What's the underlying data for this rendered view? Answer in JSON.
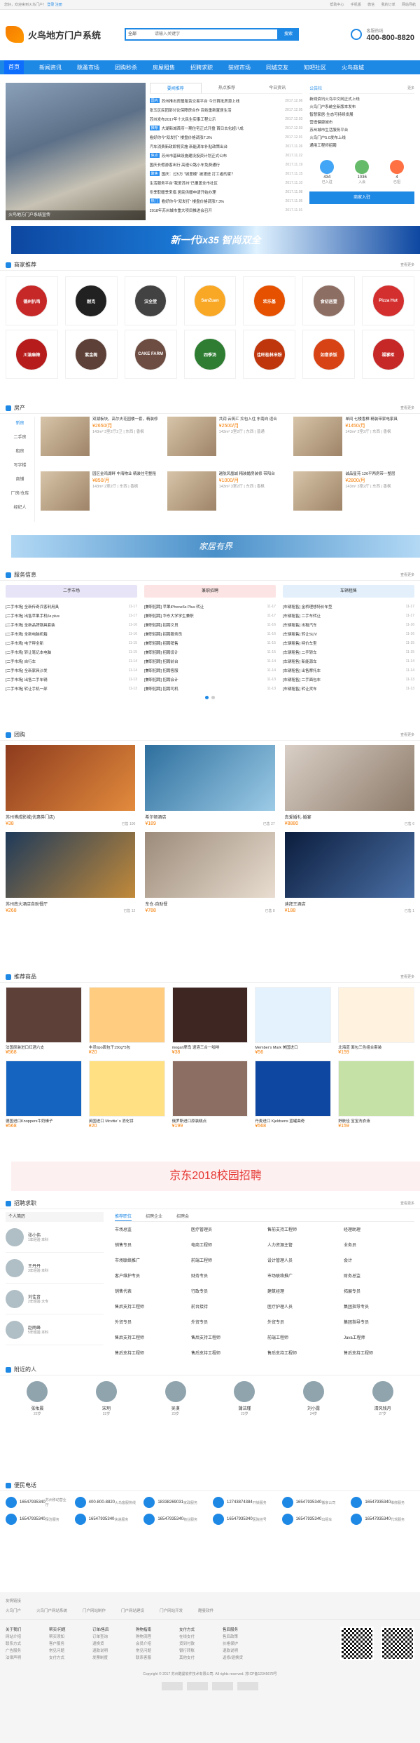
{
  "topbar": {
    "left": "您好，欢迎来到火鸟门户！",
    "login": "登录",
    "register": "注册",
    "right": [
      "帮助中心",
      "手机版",
      "微信",
      "我的订单",
      "网站导航"
    ]
  },
  "header": {
    "site": "火鸟地方门户系统",
    "search_cat": "全部",
    "search_placeholder": "请输入关键字",
    "search_btn": "搜索",
    "hot_label": "客服热线",
    "hot_phone": "400-800-8820"
  },
  "nav": [
    "首页",
    "新闻资讯",
    "跳蚤市场",
    "团购秒杀",
    "房屋租售",
    "招聘求职",
    "装修市场",
    "同城交友",
    "知吧社区",
    "火鸟商城"
  ],
  "hero": {
    "caption": "火鸟地方门户系统宣传",
    "tabs": [
      "要闻推荐",
      "热点推荐",
      "今日资讯"
    ],
    "news": [
      {
        "tag": "国内",
        "t": "苏州推出房屋租赁交易平台 今日首批房源上线",
        "d": "2017.12.06"
      },
      {
        "tag": "",
        "t": "张五区民团部讨论保障房合作 百姓重新置居生活",
        "d": "2017.12.05"
      },
      {
        "tag": "",
        "t": "苏州发布2017年十大民生实事工程公示",
        "d": "2017.12.03"
      },
      {
        "tag": "推荐",
        "t": "大湖新城首府一期住宅正式开盘 首日去化超八成",
        "d": "2017.12.03"
      },
      {
        "tag": "",
        "t": "看好你今\"双发打\" 楼盘价格调涨7.3%",
        "d": "2017.12.01"
      },
      {
        "tag": "",
        "t": "汽车消费新政即将实施 新能源车补贴政策出台",
        "d": "2017.11.26"
      },
      {
        "tag": "焦点",
        "t": "苏州市基础设施建设投资计划正式公布",
        "d": "2017.11.22"
      },
      {
        "tag": "",
        "t": "国庆长假游客出行 高速公路小车免费通行",
        "d": "2017.11.19"
      },
      {
        "tag": "聚焦",
        "t": "国庆：过5万 \"城里楼\" 被涌进 打工者的家？",
        "d": "2017.11.15"
      },
      {
        "tag": "",
        "t": "生活服务平台\"我爱苏州\"已覆盖全市社区",
        "d": "2017.11.10"
      },
      {
        "tag": "",
        "t": "冬季取暖季来临 居民供暖申请开始办理",
        "d": "2017.11.08"
      },
      {
        "tag": "热门",
        "t": "看好你今\"双发打\" 楼盘价格调涨7.3%",
        "d": "2017.11.05"
      },
      {
        "tag": "",
        "t": "2018年苏州城市重大项目推进会召开",
        "d": "2017.11.01"
      }
    ]
  },
  "notice": {
    "title": "公告栏",
    "more": "更多",
    "items": [
      "新闻资讯火鸟中文网正式上线",
      "火鸟门户系统全新版本发布",
      "智慧家居·生态可持续发展",
      "营造健康城市",
      "苏州城市生活服务平台",
      "火鸟门户5.0发布上线",
      "通用工程师招聘"
    ],
    "stats": [
      {
        "n": "434",
        "l": "已入驻"
      },
      {
        "n": "1036",
        "l": "入会"
      },
      {
        "n": "4",
        "l": "已招"
      }
    ],
    "join": "商家入驻"
  },
  "banner1": "新一代ix35 智尚双全",
  "biz": {
    "title": "商家推荐",
    "more": "查看更多",
    "items": [
      "德州扒鸡",
      "耐克",
      "汉全堂",
      "SanZuan",
      "欢乐基",
      "食初居壹",
      "Pizza Hut",
      "川渝麻辣",
      "紫金阁",
      "CAKE FARM",
      "四季汤",
      "佳旺桂林米粉",
      "如意茶饭",
      "福掌柜"
    ]
  },
  "house": {
    "title": "房产",
    "more": "查看更多",
    "side": [
      "新房",
      "二手房",
      "租房",
      "写字楼",
      "商铺",
      "厂房/仓库",
      "经纪人"
    ],
    "items": [
      {
        "t": "双湖板块，高尔夫花园楼一套，精装修",
        "p": "2650",
        "u": "/月",
        "s": "143m² 3室2厅2卫 | 东西 | 香枫"
      },
      {
        "t": "共润 云筑汇 拎包入住 东南向 适合",
        "p": "2500",
        "u": "/月",
        "s": "143m² 3室2厅 | 东西 | 普通"
      },
      {
        "t": "单间 七楼香樟 精装带家电家具",
        "p": "1450",
        "u": "/月",
        "s": "143m² 2室2厅 | 东西 | 香枫"
      },
      {
        "t": "园区金鸡湖畔 中海物业 精装住宅整租",
        "p": "850",
        "u": "/月",
        "s": "143m² 2室2厅 | 东西 | 香枫"
      },
      {
        "t": "越航凤凰城 精装婚房装修 带阳台",
        "p": "1000",
        "u": "/月",
        "s": "143m² 3室2厅 | 东西 | 香枫"
      },
      {
        "t": "诚品星苑 126平两房带一整层",
        "p": "2800",
        "u": "/月",
        "s": "143m² 3室2厅 | 东西 | 香枫"
      }
    ]
  },
  "banner2": "家居有界",
  "svc": {
    "title": "服务信息",
    "more": "查看更多",
    "tabs": [
      "二手市场",
      "兼职招聘",
      "车辆租售"
    ],
    "cols": [
      [
        "[二手市场] 全新传奇兵客利用具",
        "[二手市场] 出售苹果手机6s plus",
        "[二手市场] 全新品牌锅具套装",
        "[二手市场] 全新电脑机箱",
        "[二手市场] 电子秤全新",
        "[二手市场] 转让笔记本电脑",
        "[二手市场] 自行车",
        "[二手市场] 全新家具沙发",
        "[二手市场] 出售二手车辆",
        "[二手市场] 转让手机一部"
      ],
      [
        "[兼职招聘] 苹果iPhone6s Plus 转让",
        "[兼职招聘] 华东大学学生兼职",
        "[兼职招聘] 招聘文员",
        "[兼职招聘] 招聘服务员",
        "[兼职招聘] 招聘销售",
        "[兼职招聘] 招聘设计",
        "[兼职招聘] 招聘前台",
        "[兼职招聘] 招聘客服",
        "[兼职招聘] 招聘会计",
        "[兼职招聘] 招聘司机"
      ],
      [
        "[车辆租售] 金桥理想特价车型",
        "[车辆租售] 二手车转让",
        "[车辆租售] 出租汽车",
        "[车辆租售] 转让SUV",
        "[车辆租售] 特价车型",
        "[车辆租售] 二手轿车",
        "[车辆租售] 新能源车",
        "[车辆租售] 出售摩托车",
        "[车辆租售] 二手面包车",
        "[车辆租售] 转让货车"
      ]
    ],
    "dates": [
      "11-17",
      "11-17",
      "11-16",
      "11-16",
      "11-15",
      "11-15",
      "11-14",
      "11-14",
      "11-13",
      "11-13"
    ]
  },
  "group": {
    "title": "团购",
    "more": "查看更多",
    "items": [
      {
        "t": "苏州博成影城(优惠券门店)",
        "p": "38",
        "s": "已售 100"
      },
      {
        "t": "希尔顿酒店",
        "p": "189",
        "s": "已售 27"
      },
      {
        "t": "真爱婚礼·婚宴",
        "p": "8880",
        "s": "已售 6"
      },
      {
        "t": "苏州南大酒店自助餐厅",
        "p": "268",
        "s": "已售 12"
      },
      {
        "t": "东仓·自助餐",
        "p": "788",
        "s": "已售 8"
      },
      {
        "t": "迪拜王酒店",
        "p": "188",
        "s": "已售 1"
      }
    ]
  },
  "goods": {
    "title": "推荐商品",
    "more": "查看更多",
    "items": [
      {
        "t": "法国原装进口红酒六支",
        "p": "568"
      },
      {
        "t": "丰灵tipo面包干150g*5包",
        "p": "20"
      },
      {
        "t": "mogarl摩岛 速溶三合一咖啡",
        "p": "38"
      },
      {
        "t": "Member's Mark 美国进口",
        "p": "56"
      },
      {
        "t": "北海道 面包三色组合套装",
        "p": "159"
      },
      {
        "t": "德国进口Knoppers牛奶榛子",
        "p": "568"
      },
      {
        "t": "英国进口 Mcvitie' s 消化饼",
        "p": "20"
      },
      {
        "t": "俄罗斯进口原装糕点",
        "p": "199"
      },
      {
        "t": "丹麦进口 Kjeldsens 蓝罐曲奇",
        "p": "568"
      },
      {
        "t": "舒肤佳 宝宝洗衣液",
        "p": "159"
      }
    ]
  },
  "banner3": "京东2018校园招聘",
  "jobs": {
    "title": "招聘求职",
    "more": "查看更多",
    "people_title": "个人简历",
    "people": [
      {
        "n": "张小伟",
        "s": "1年经验 本科"
      },
      {
        "n": "王丹丹",
        "s": "3年经验 本科"
      },
      {
        "n": "刘佳音",
        "s": "2年经验 大专"
      },
      {
        "n": "赵雨峰",
        "s": "5年经验 本科"
      }
    ],
    "tabs": [
      "推荐职位",
      "招聘企业",
      "招聘会"
    ],
    "list": [
      [
        "市场总监",
        "销售专员",
        "市场联络推广",
        "客户维护专员",
        "销售代表",
        "售后支持工程师",
        "外贸专员",
        "售后支持工程师",
        "售后支持工程师"
      ],
      [
        "医疗管理员",
        "电商工程师",
        "前端工程师",
        "财务专员",
        "行政专员",
        "前台接待",
        "外贸专员",
        "售后支持工程师",
        "售后支持工程师"
      ],
      [
        "售前支持工程师",
        "人力资源主管",
        "设计管理人员",
        "市场联络推广",
        "建筑经理",
        "医疗护理人员",
        "外贸专员",
        "前端工程师",
        "售后支持工程师"
      ],
      [
        "经理助理",
        "业务员",
        "会计",
        "财务总监",
        "拓展专员",
        "集团指导专员",
        "集团指导专员",
        "Java工程师",
        "售后支持工程师"
      ]
    ]
  },
  "near": {
    "title": "附近的人",
    "people": [
      {
        "n": "张佑晨",
        "s": "22岁"
      },
      {
        "n": "宋玥",
        "s": "22岁"
      },
      {
        "n": "吴漠",
        "s": "23岁"
      },
      {
        "n": "蒲洁瑾",
        "s": "23岁"
      },
      {
        "n": "刘小露",
        "s": "24岁"
      },
      {
        "n": "清风残月",
        "s": "27岁"
      }
    ]
  },
  "phone": {
    "title": "便民电话",
    "items": [
      {
        "n": "16547935340",
        "s": "苏州移动营业厅"
      },
      {
        "n": "400-800-8820",
        "s": "火鸟客服热线"
      },
      {
        "n": "18338269031",
        "s": "家政服务"
      },
      {
        "n": "12743874384",
        "s": "开锁服务"
      },
      {
        "n": "16547935340",
        "s": "搬家公司"
      },
      {
        "n": "16547935340",
        "s": "维修服务"
      },
      {
        "n": "16547935340",
        "s": "保洁服务"
      },
      {
        "n": "16547935340",
        "s": "快递服务"
      },
      {
        "n": "16547935340",
        "s": "物业服务"
      },
      {
        "n": "16547935340",
        "s": "医院挂号"
      },
      {
        "n": "16547935340",
        "s": "出租车"
      },
      {
        "n": "16547935340",
        "s": "代驾服务"
      }
    ]
  },
  "footer": {
    "links_title": "友情链接",
    "links": [
      "火鸟门户",
      "火鸟门户网站系统",
      "门户网站制作",
      "门户网站建设",
      "门户网站开发",
      "酷曼软件"
    ],
    "cols": [
      {
        "h": "关于我们",
        "i": [
          "网站介绍",
          "联系方式",
          "广告服务",
          "法律声明"
        ]
      },
      {
        "h": "帮买/问题",
        "i": [
          "帮买须知",
          "客户服务",
          "常见问题",
          "支付方式"
        ]
      },
      {
        "h": "订单/售后",
        "i": [
          "订单查询",
          "退换货",
          "退款说明",
          "发票制度"
        ]
      },
      {
        "h": "购物指南",
        "i": [
          "购物流程",
          "会员介绍",
          "常见问题",
          "联系客服"
        ]
      },
      {
        "h": "支付方式",
        "i": [
          "在线支付",
          "货到付款",
          "银行转账",
          "其他支付"
        ]
      },
      {
        "h": "售后服务",
        "i": [
          "售后政策",
          "价格保护",
          "退款说明",
          "返修/退换货"
        ]
      }
    ],
    "copy": "Copyright © 2017 苏州酷曼软件技术有限公司. All rights reserved. 苏ICP备12345678号"
  }
}
